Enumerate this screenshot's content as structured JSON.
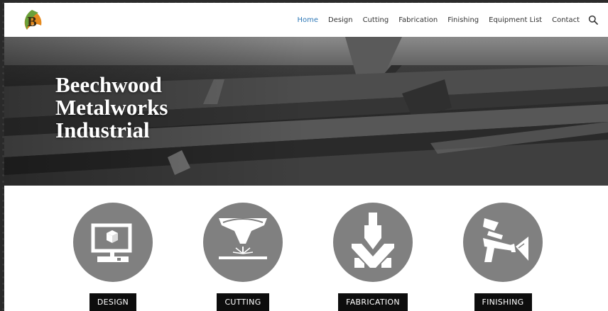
{
  "logo": {
    "letter": "B"
  },
  "nav": {
    "items": [
      {
        "label": "Home",
        "active": true
      },
      {
        "label": "Design",
        "active": false
      },
      {
        "label": "Cutting",
        "active": false
      },
      {
        "label": "Fabrication",
        "active": false
      },
      {
        "label": "Finishing",
        "active": false
      },
      {
        "label": "Equipment List",
        "active": false
      },
      {
        "label": "Contact",
        "active": false
      }
    ],
    "active_color": "#2e78b7"
  },
  "hero": {
    "title_lines": [
      "Beechwood",
      "Metalworks",
      "Industrial"
    ]
  },
  "services": [
    {
      "label": "DESIGN",
      "icon": "computer-cube-icon"
    },
    {
      "label": "CUTTING",
      "icon": "laser-cutter-icon"
    },
    {
      "label": "FABRICATION",
      "icon": "press-brake-icon"
    },
    {
      "label": "FINISHING",
      "icon": "spray-gun-icon"
    }
  ],
  "colors": {
    "icon_circle": "#808080",
    "button_bg": "#0d0d0d"
  }
}
